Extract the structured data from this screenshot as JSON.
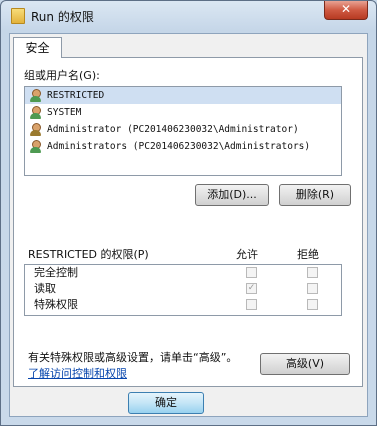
{
  "window": {
    "title": "Run 的权限",
    "close_glyph": "✕"
  },
  "tab": {
    "label": "安全"
  },
  "groups": {
    "label": "组或用户名(G):",
    "items": [
      {
        "name": "RESTRICTED",
        "icon": "user-group-icon"
      },
      {
        "name": "SYSTEM",
        "icon": "user-group-icon"
      },
      {
        "name": "Administrator (PC201406230032\\Administrator)",
        "icon": "user-icon"
      },
      {
        "name": "Administrators (PC201406230032\\Administrators)",
        "icon": "user-group-icon"
      }
    ],
    "selected_index": 0
  },
  "buttons": {
    "add": "添加(D)...",
    "remove": "删除(R)",
    "advanced": "高级(V)",
    "ok": "确定"
  },
  "permissions": {
    "label": "RESTRICTED 的权限(P)",
    "allow_header": "允许",
    "deny_header": "拒绝",
    "rows": [
      {
        "name": "完全控制",
        "allow": false,
        "deny": false
      },
      {
        "name": "读取",
        "allow": true,
        "deny": false
      },
      {
        "name": "特殊权限",
        "allow": false,
        "deny": false
      }
    ]
  },
  "advanced_text": "有关特殊权限或高级设置，请单击“高级”。",
  "learn_link": "了解访问控制和权限",
  "colors": {
    "selection": "#cfdff2",
    "link": "#0645ad"
  }
}
